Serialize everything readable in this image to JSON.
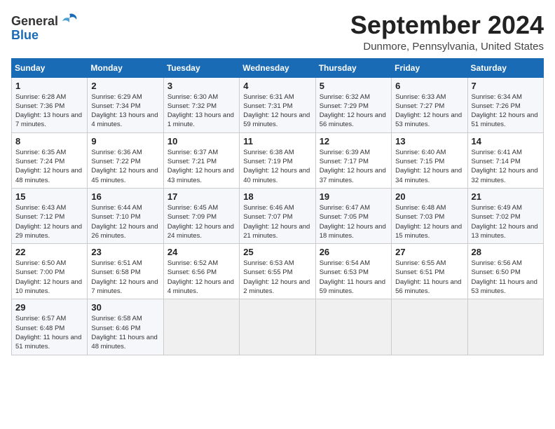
{
  "header": {
    "logo_general": "General",
    "logo_blue": "Blue",
    "month_title": "September 2024",
    "location": "Dunmore, Pennsylvania, United States"
  },
  "weekdays": [
    "Sunday",
    "Monday",
    "Tuesday",
    "Wednesday",
    "Thursday",
    "Friday",
    "Saturday"
  ],
  "weeks": [
    [
      {
        "day": "1",
        "sunrise": "Sunrise: 6:28 AM",
        "sunset": "Sunset: 7:36 PM",
        "daylight": "Daylight: 13 hours and 7 minutes."
      },
      {
        "day": "2",
        "sunrise": "Sunrise: 6:29 AM",
        "sunset": "Sunset: 7:34 PM",
        "daylight": "Daylight: 13 hours and 4 minutes."
      },
      {
        "day": "3",
        "sunrise": "Sunrise: 6:30 AM",
        "sunset": "Sunset: 7:32 PM",
        "daylight": "Daylight: 13 hours and 1 minute."
      },
      {
        "day": "4",
        "sunrise": "Sunrise: 6:31 AM",
        "sunset": "Sunset: 7:31 PM",
        "daylight": "Daylight: 12 hours and 59 minutes."
      },
      {
        "day": "5",
        "sunrise": "Sunrise: 6:32 AM",
        "sunset": "Sunset: 7:29 PM",
        "daylight": "Daylight: 12 hours and 56 minutes."
      },
      {
        "day": "6",
        "sunrise": "Sunrise: 6:33 AM",
        "sunset": "Sunset: 7:27 PM",
        "daylight": "Daylight: 12 hours and 53 minutes."
      },
      {
        "day": "7",
        "sunrise": "Sunrise: 6:34 AM",
        "sunset": "Sunset: 7:26 PM",
        "daylight": "Daylight: 12 hours and 51 minutes."
      }
    ],
    [
      {
        "day": "8",
        "sunrise": "Sunrise: 6:35 AM",
        "sunset": "Sunset: 7:24 PM",
        "daylight": "Daylight: 12 hours and 48 minutes."
      },
      {
        "day": "9",
        "sunrise": "Sunrise: 6:36 AM",
        "sunset": "Sunset: 7:22 PM",
        "daylight": "Daylight: 12 hours and 45 minutes."
      },
      {
        "day": "10",
        "sunrise": "Sunrise: 6:37 AM",
        "sunset": "Sunset: 7:21 PM",
        "daylight": "Daylight: 12 hours and 43 minutes."
      },
      {
        "day": "11",
        "sunrise": "Sunrise: 6:38 AM",
        "sunset": "Sunset: 7:19 PM",
        "daylight": "Daylight: 12 hours and 40 minutes."
      },
      {
        "day": "12",
        "sunrise": "Sunrise: 6:39 AM",
        "sunset": "Sunset: 7:17 PM",
        "daylight": "Daylight: 12 hours and 37 minutes."
      },
      {
        "day": "13",
        "sunrise": "Sunrise: 6:40 AM",
        "sunset": "Sunset: 7:15 PM",
        "daylight": "Daylight: 12 hours and 34 minutes."
      },
      {
        "day": "14",
        "sunrise": "Sunrise: 6:41 AM",
        "sunset": "Sunset: 7:14 PM",
        "daylight": "Daylight: 12 hours and 32 minutes."
      }
    ],
    [
      {
        "day": "15",
        "sunrise": "Sunrise: 6:43 AM",
        "sunset": "Sunset: 7:12 PM",
        "daylight": "Daylight: 12 hours and 29 minutes."
      },
      {
        "day": "16",
        "sunrise": "Sunrise: 6:44 AM",
        "sunset": "Sunset: 7:10 PM",
        "daylight": "Daylight: 12 hours and 26 minutes."
      },
      {
        "day": "17",
        "sunrise": "Sunrise: 6:45 AM",
        "sunset": "Sunset: 7:09 PM",
        "daylight": "Daylight: 12 hours and 24 minutes."
      },
      {
        "day": "18",
        "sunrise": "Sunrise: 6:46 AM",
        "sunset": "Sunset: 7:07 PM",
        "daylight": "Daylight: 12 hours and 21 minutes."
      },
      {
        "day": "19",
        "sunrise": "Sunrise: 6:47 AM",
        "sunset": "Sunset: 7:05 PM",
        "daylight": "Daylight: 12 hours and 18 minutes."
      },
      {
        "day": "20",
        "sunrise": "Sunrise: 6:48 AM",
        "sunset": "Sunset: 7:03 PM",
        "daylight": "Daylight: 12 hours and 15 minutes."
      },
      {
        "day": "21",
        "sunrise": "Sunrise: 6:49 AM",
        "sunset": "Sunset: 7:02 PM",
        "daylight": "Daylight: 12 hours and 13 minutes."
      }
    ],
    [
      {
        "day": "22",
        "sunrise": "Sunrise: 6:50 AM",
        "sunset": "Sunset: 7:00 PM",
        "daylight": "Daylight: 12 hours and 10 minutes."
      },
      {
        "day": "23",
        "sunrise": "Sunrise: 6:51 AM",
        "sunset": "Sunset: 6:58 PM",
        "daylight": "Daylight: 12 hours and 7 minutes."
      },
      {
        "day": "24",
        "sunrise": "Sunrise: 6:52 AM",
        "sunset": "Sunset: 6:56 PM",
        "daylight": "Daylight: 12 hours and 4 minutes."
      },
      {
        "day": "25",
        "sunrise": "Sunrise: 6:53 AM",
        "sunset": "Sunset: 6:55 PM",
        "daylight": "Daylight: 12 hours and 2 minutes."
      },
      {
        "day": "26",
        "sunrise": "Sunrise: 6:54 AM",
        "sunset": "Sunset: 6:53 PM",
        "daylight": "Daylight: 11 hours and 59 minutes."
      },
      {
        "day": "27",
        "sunrise": "Sunrise: 6:55 AM",
        "sunset": "Sunset: 6:51 PM",
        "daylight": "Daylight: 11 hours and 56 minutes."
      },
      {
        "day": "28",
        "sunrise": "Sunrise: 6:56 AM",
        "sunset": "Sunset: 6:50 PM",
        "daylight": "Daylight: 11 hours and 53 minutes."
      }
    ],
    [
      {
        "day": "29",
        "sunrise": "Sunrise: 6:57 AM",
        "sunset": "Sunset: 6:48 PM",
        "daylight": "Daylight: 11 hours and 51 minutes."
      },
      {
        "day": "30",
        "sunrise": "Sunrise: 6:58 AM",
        "sunset": "Sunset: 6:46 PM",
        "daylight": "Daylight: 11 hours and 48 minutes."
      },
      null,
      null,
      null,
      null,
      null
    ]
  ]
}
